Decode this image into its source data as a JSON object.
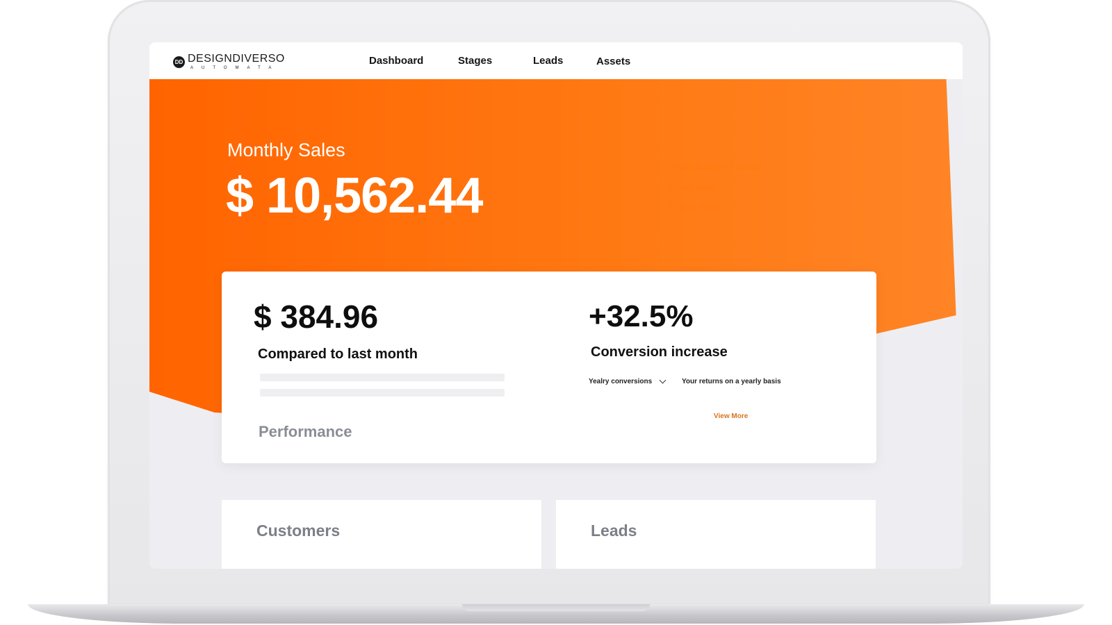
{
  "brand": {
    "mark": "DD",
    "name": "DESIGNDIVERSO",
    "subtitle": "AUTOMATA"
  },
  "nav": {
    "items": [
      {
        "label": "Dashboard"
      },
      {
        "label": "Stages"
      },
      {
        "label": "Leads"
      },
      {
        "label": "Assets"
      }
    ]
  },
  "hero": {
    "title": "Monthly Sales",
    "value": "$ 10,562.44",
    "ghost_list": [
      "Small business owner",
      "Loves food",
      "Enjoys hiking"
    ]
  },
  "card": {
    "amount": "$ 384.96",
    "compare_label": "Compared to last month",
    "performance_label": "Performance",
    "percent": "+32.5%",
    "conversion_label": "Conversion increase",
    "select_value": "Yealry conversions",
    "returns_text": "Your returns on a yearly basis",
    "view_more": "View More"
  },
  "panels": {
    "customers": "Customers",
    "leads": "Leads"
  },
  "colors": {
    "accent": "#ff6a00",
    "link": "#d9741c",
    "screen_bg": "#eeeef2"
  }
}
